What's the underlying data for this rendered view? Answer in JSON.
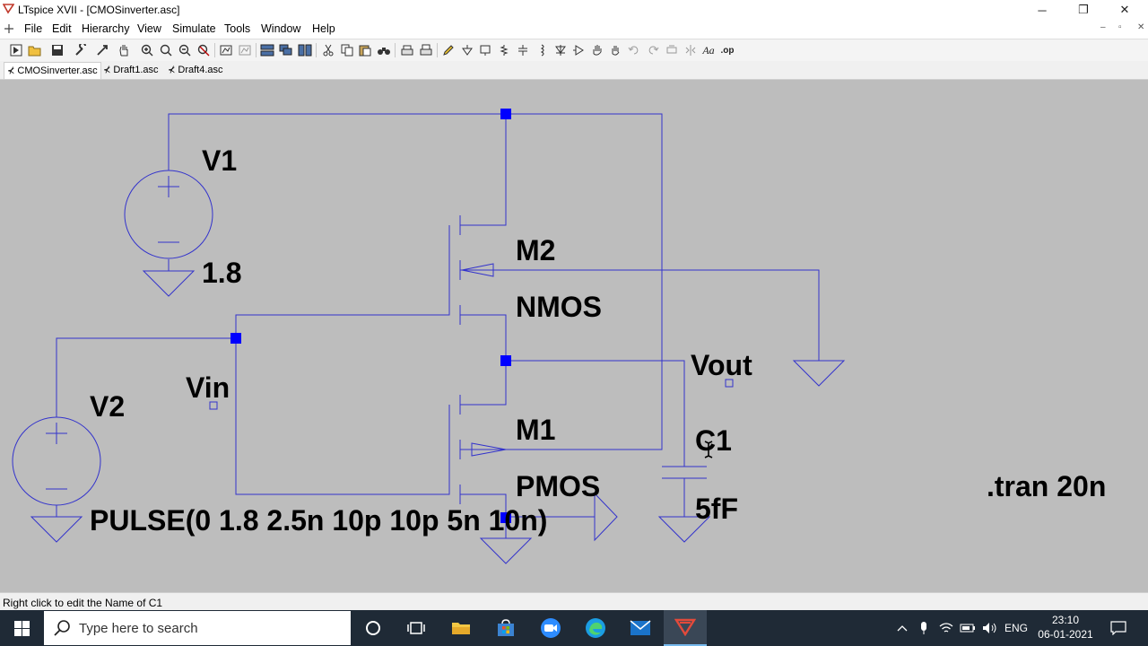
{
  "window": {
    "title": "LTspice XVII - [CMOSinverter.asc]",
    "min": "─",
    "restore": "❐",
    "close": "✕"
  },
  "menu": {
    "items": [
      "File",
      "Edit",
      "Hierarchy",
      "View",
      "Simulate",
      "Tools",
      "Window",
      "Help"
    ],
    "mdi_min": "–",
    "mdi_restore": "▫",
    "mdi_close": "✕"
  },
  "tabs": [
    {
      "label": "CMOSinverter.asc",
      "active": true
    },
    {
      "label": "Draft1.asc",
      "active": false
    },
    {
      "label": "Draft4.asc",
      "active": false
    }
  ],
  "schematic": {
    "v1_name": "V1",
    "v1_value": "1.8",
    "v2_name": "V2",
    "v2_value": "PULSE(0 1.8 2.5n 10p 10p 5n 10n)",
    "m2_name": "M2",
    "m2_model": "NMOS",
    "m1_name": "M1",
    "m1_model": "PMOS",
    "c1_name": "C1",
    "c1_value": "5fF",
    "vin_label": "Vin",
    "vout_label": "Vout",
    "directive": ".tran 20n",
    "colors": {
      "background": "#bdbdbd",
      "wire": "#3333cc",
      "junction": "#0000ff",
      "text": "#000000"
    }
  },
  "status": {
    "text": "Right click to edit the Name of C1"
  },
  "taskbar": {
    "search_placeholder": "Type here to search",
    "lang": "ENG",
    "time": "23:10",
    "date": "06-01-2021"
  }
}
